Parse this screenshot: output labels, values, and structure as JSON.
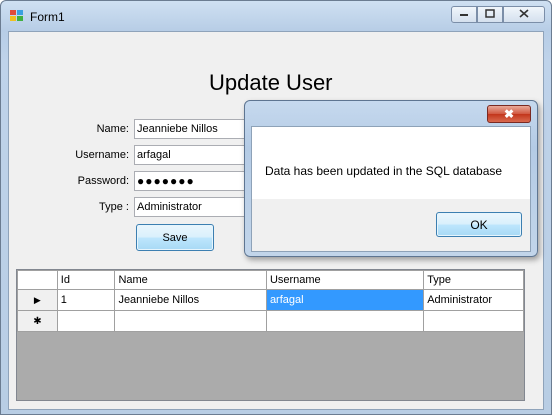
{
  "window": {
    "title": "Form1"
  },
  "form": {
    "heading": "Update User",
    "name_label": "Name:",
    "name_value": "Jeanniebe Nillos",
    "username_label": "Username:",
    "username_value": "arfagal",
    "password_label": "Password:",
    "password_value": "●●●●●●●",
    "type_label": "Type :",
    "type_value": "Administrator",
    "save_label": "Save"
  },
  "grid": {
    "columns": [
      "Id",
      "Name",
      "Username",
      "Type"
    ],
    "rows": [
      {
        "id": "1",
        "name": "Jeanniebe Nillos",
        "username": "arfagal",
        "type": "Administrator"
      }
    ],
    "current_row_marker": "▶",
    "new_row_marker": "✱",
    "selection_color": "#3399ff"
  },
  "dialog": {
    "close_glyph": "✖",
    "message": "Data has been updated in the SQL database",
    "ok_label": "OK"
  },
  "icons": {
    "minimize": "minimize-icon",
    "maximize": "maximize-icon",
    "close": "close-icon"
  }
}
